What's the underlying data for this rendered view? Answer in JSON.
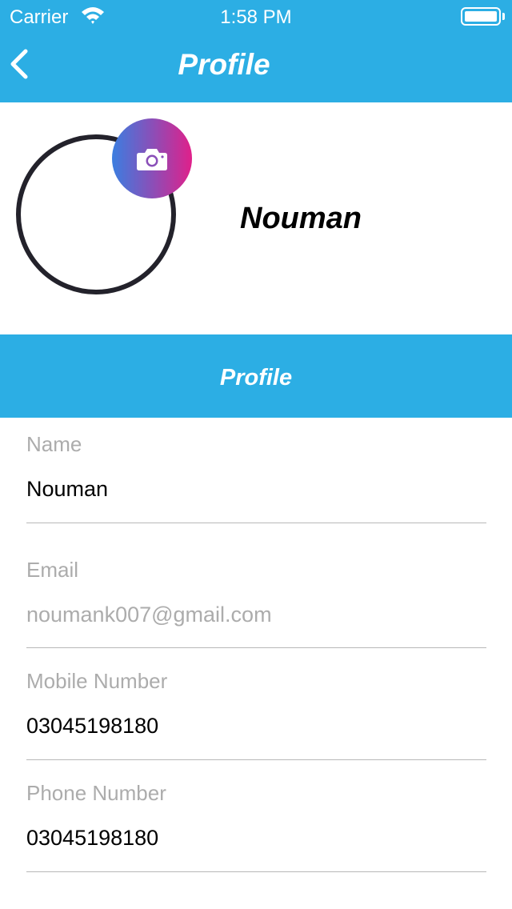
{
  "status_bar": {
    "carrier": "Carrier",
    "time": "1:58 PM",
    "wifi_icon": "wifi-icon",
    "battery_icon": "battery-icon"
  },
  "nav": {
    "title": "Profile",
    "back_icon": "chevron-left-icon"
  },
  "profile": {
    "name": "Nouman",
    "camera_icon": "camera-icon"
  },
  "section": {
    "title": "Profile"
  },
  "fields": [
    {
      "label": "Name",
      "value": "Nouman"
    },
    {
      "label": "Email",
      "value": "noumank007@gmail.com"
    },
    {
      "label": "Mobile Number",
      "value": "03045198180"
    },
    {
      "label": "Phone Number",
      "value": "03045198180"
    }
  ],
  "colors": {
    "accent": "#2caee4",
    "text_primary": "#000000",
    "text_muted": "#acacac",
    "avatar_ring": "#23222b",
    "camera_gradient_start": "#3b7ee0",
    "camera_gradient_end": "#e0208a"
  }
}
